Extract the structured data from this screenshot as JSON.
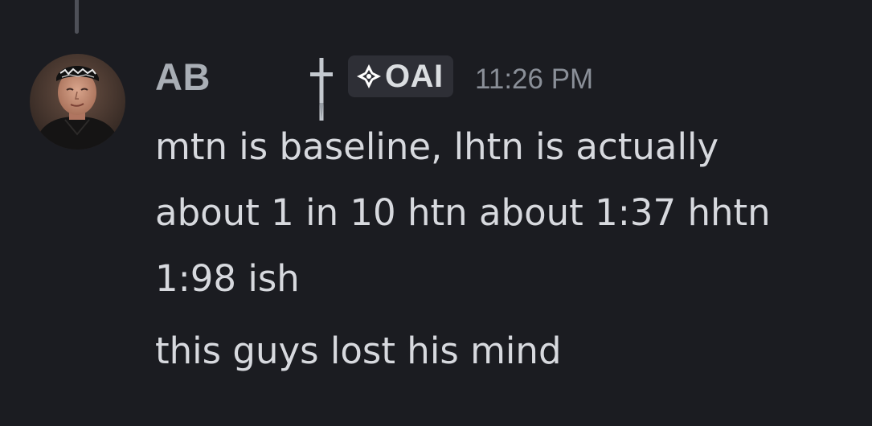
{
  "message": {
    "author": "AB",
    "tag_label": "OAI",
    "timestamp": "11:26 PM",
    "content_lines": [
      "mtn is baseline, lhtn is actually",
      "about 1 in 10 htn about 1:37 hhtn",
      "1:98 ish",
      "this guys lost his mind"
    ]
  },
  "icons": {
    "role_icon": "latin-cross-icon",
    "tag_icon": "diamond-sparkle-icon"
  },
  "colors": {
    "background": "#1b1c21",
    "username": "#a9aeb5",
    "tag_background": "#2e2f36",
    "timestamp": "#8a8f98",
    "message_text": "#d7d9de"
  }
}
